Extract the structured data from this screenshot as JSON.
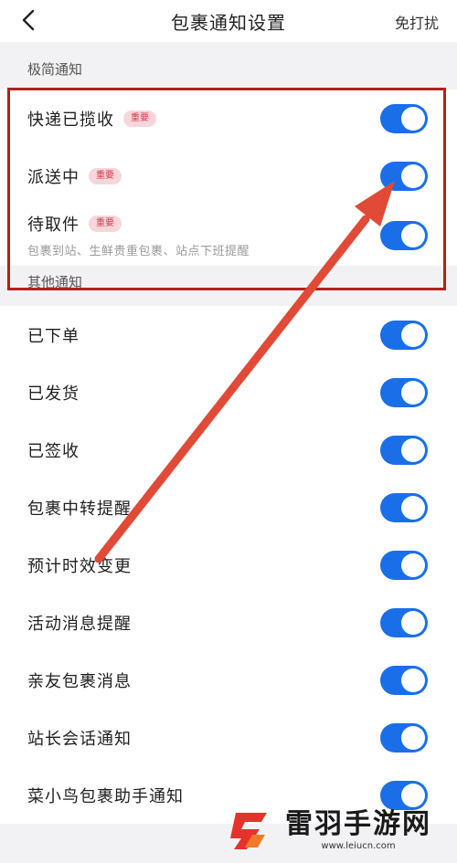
{
  "nav": {
    "title": "包裹通知设置",
    "right_action": "免打扰"
  },
  "sections": [
    {
      "header": "极简通知",
      "items": [
        {
          "label": "快递已揽收",
          "badge": "重要",
          "enabled": true
        },
        {
          "label": "派送中",
          "badge": "重要",
          "enabled": true
        },
        {
          "label": "待取件",
          "badge": "重要",
          "sub": "包裹到站、生鲜贵重包裹、站点下班提醒",
          "enabled": true
        }
      ]
    },
    {
      "header": "其他通知",
      "items": [
        {
          "label": "已下单",
          "enabled": true
        },
        {
          "label": "已发货",
          "enabled": true
        },
        {
          "label": "已签收",
          "enabled": true
        },
        {
          "label": "包裹中转提醒",
          "enabled": true
        },
        {
          "label": "预计时效变更",
          "enabled": true
        },
        {
          "label": "活动消息提醒",
          "enabled": true
        },
        {
          "label": "亲友包裹消息",
          "enabled": true
        },
        {
          "label": "站长会话通知",
          "enabled": true
        },
        {
          "label": "菜小鸟包裹助手通知",
          "enabled": true
        }
      ]
    }
  ],
  "watermark": {
    "name": "雷羽手游网",
    "url": "www.leiucn.com"
  },
  "colors": {
    "toggle_on": "#1a6fe8",
    "badge_bg": "#f7d6da",
    "badge_text": "#d23a4f",
    "highlight": "#b41f1f",
    "arrow": "#e04a36"
  }
}
